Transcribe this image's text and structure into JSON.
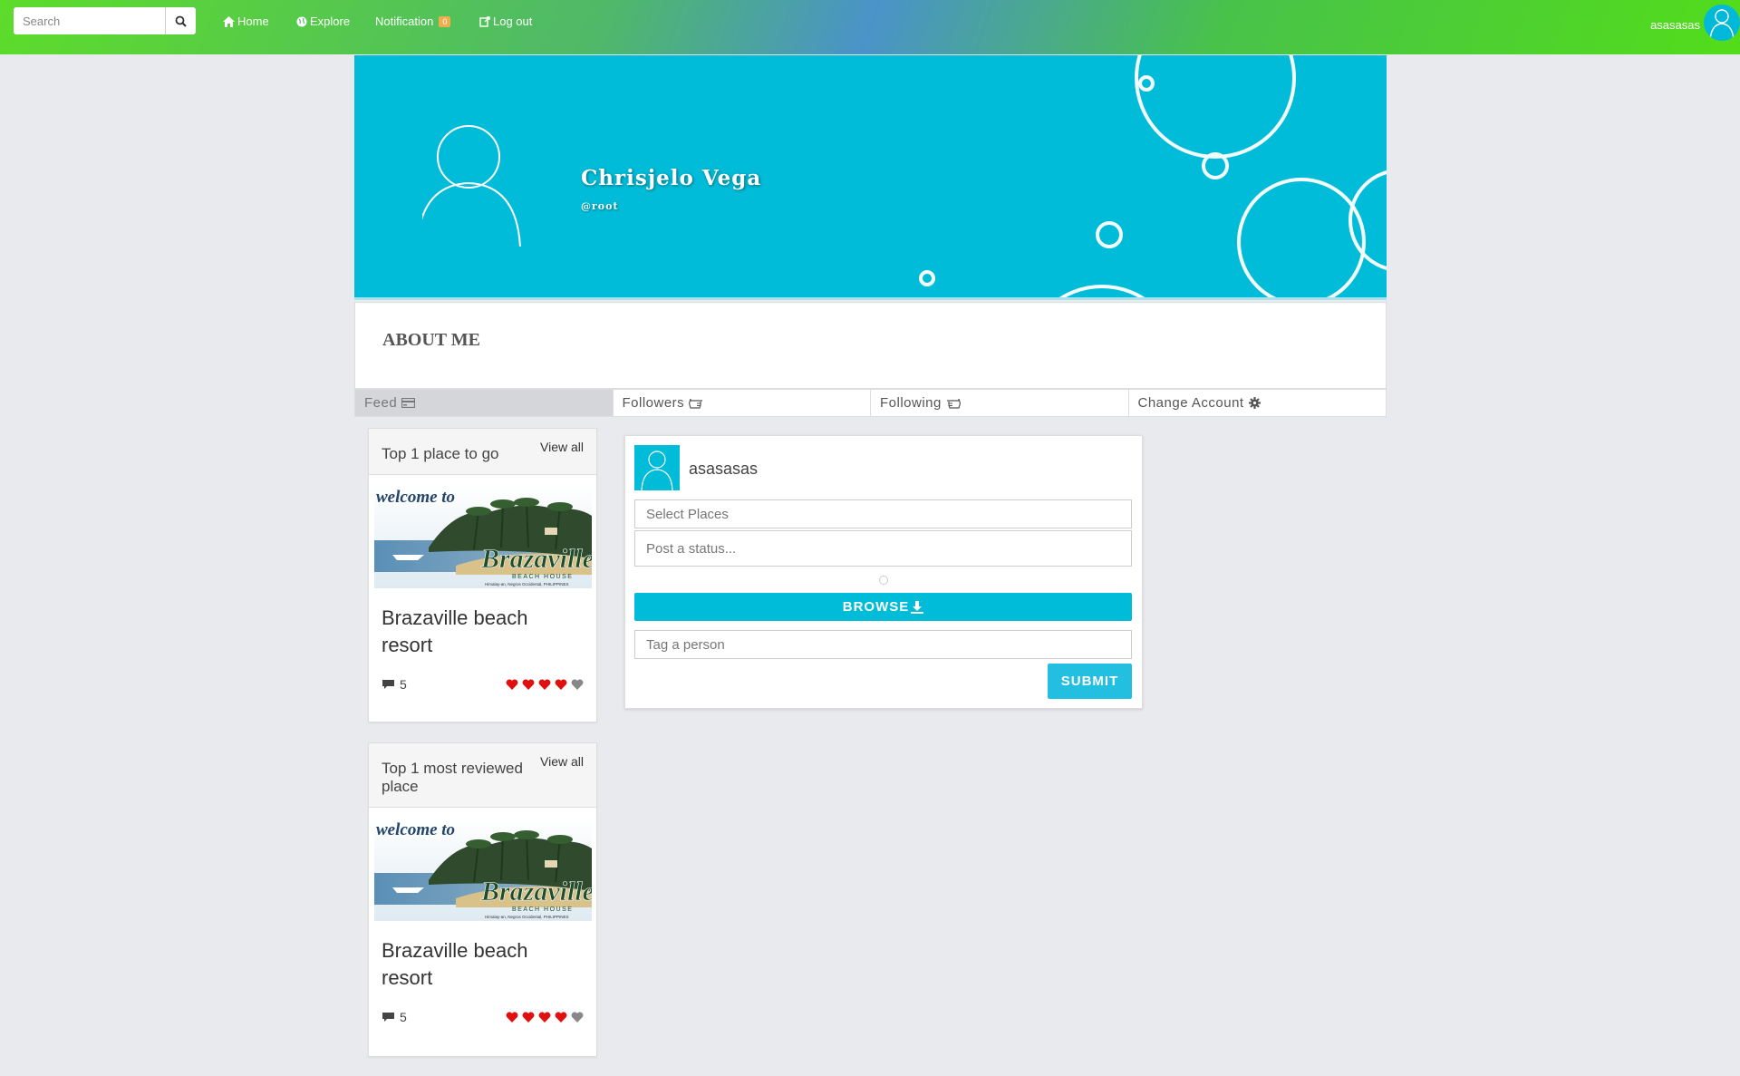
{
  "topbar": {
    "search_placeholder": "Search",
    "nav": {
      "home": "Home",
      "explore": "Explore",
      "notification": "Notification",
      "notification_count": "0",
      "logout": "Log out"
    },
    "username": "asasasas"
  },
  "profile": {
    "name": "Chrisjelo Vega",
    "handle": "@root",
    "cover_color": "#00bcd8"
  },
  "about": {
    "title": "ABOUT ME"
  },
  "tabs": [
    {
      "label": "Feed",
      "icon": "card-icon"
    },
    {
      "label": "Followers",
      "icon": "hand-left-icon"
    },
    {
      "label": "Following",
      "icon": "hand-right-icon"
    },
    {
      "label": "Change Account",
      "icon": "gear-icon"
    }
  ],
  "top_places": {
    "title": "Top 1 place to go",
    "view_all": "View all",
    "place_name": "Brazaville beach resort",
    "comments": "5",
    "rating": 4,
    "rating_max": 5,
    "image_text": {
      "welcome": "welcome to",
      "brand": "Brazaville",
      "sub": "BEACH HOUSE",
      "loc": "Himalay-an, Negros Occidental, PHILIPPINES"
    }
  },
  "top_reviewed": {
    "title": "Top 1 most reviewed place",
    "view_all": "View all",
    "place_name": "Brazaville beach resort",
    "comments": "5",
    "rating": 4,
    "rating_max": 5,
    "image_text": {
      "welcome": "welcome to",
      "brand": "Brazaville",
      "sub": "BEACH HOUSE",
      "loc": "Himalay-an, Negros Occidental, PHILIPPINES"
    }
  },
  "post": {
    "username": "asasasas",
    "select_places_placeholder": "Select Places",
    "status_placeholder": "Post a status...",
    "browse_label": "BROWSE",
    "tag_placeholder": "Tag a person",
    "submit_label": "SUBMIT"
  },
  "colors": {
    "accent": "#00bcd8",
    "heart_on": "#e01010",
    "heart_off": "#888888"
  }
}
